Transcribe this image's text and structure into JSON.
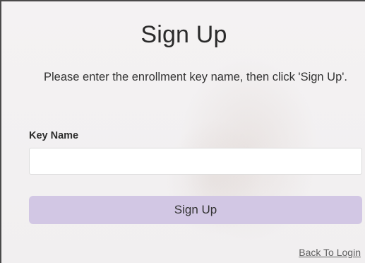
{
  "form": {
    "title": "Sign Up",
    "instruction": "Please enter the enrollment key name, then click 'Sign Up'.",
    "key_name_label": "Key Name",
    "key_name_value": "",
    "key_name_placeholder": "",
    "submit_label": "Sign Up",
    "back_link_label": "Back To Login"
  },
  "colors": {
    "button_background": "#d2c7e4",
    "page_background": "#f3f1f2"
  }
}
